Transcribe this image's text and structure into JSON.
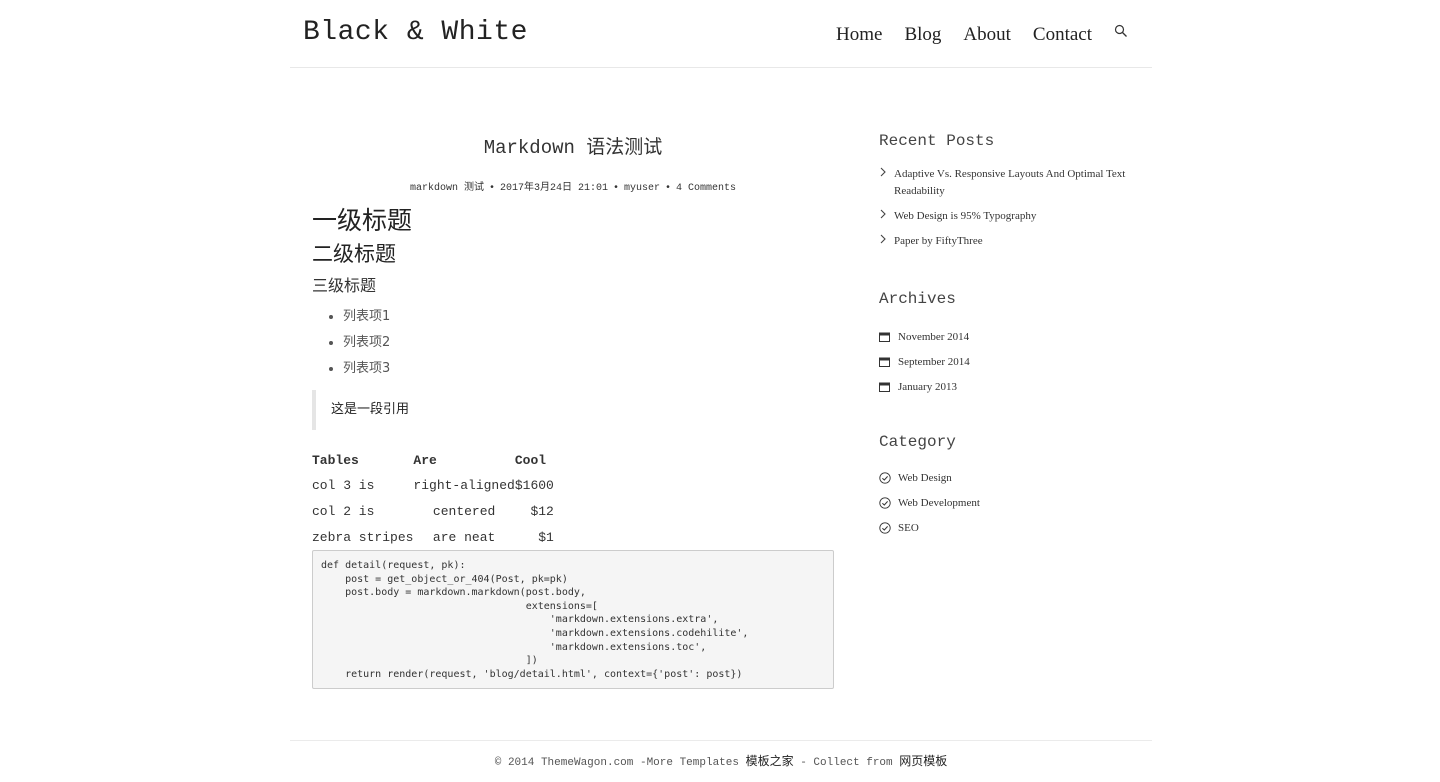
{
  "site": {
    "title": "Black & White"
  },
  "nav": {
    "items": [
      "Home",
      "Blog",
      "About",
      "Contact"
    ]
  },
  "post": {
    "title": "Markdown 语法测试",
    "meta": {
      "category": "markdown 测试",
      "date": "2017年3月24日 21:01",
      "author": "myuser",
      "comments": "4 Comments"
    },
    "h1": "一级标题",
    "h2": "二级标题",
    "h3": "三级标题",
    "list": [
      "列表项1",
      "列表项2",
      "列表项3"
    ],
    "quote": "这是一段引用",
    "table": {
      "headers": [
        "Tables",
        "Are",
        "Cool"
      ],
      "rows": [
        [
          "col 3 is",
          "right-aligned",
          "$1600"
        ],
        [
          "col 2 is",
          "centered",
          "$12"
        ],
        [
          "zebra stripes",
          "are neat",
          "$1"
        ]
      ]
    },
    "code": "def detail(request, pk):\n    post = get_object_or_404(Post, pk=pk)\n    post.body = markdown.markdown(post.body,\n                                  extensions=[\n                                      'markdown.extensions.extra',\n                                      'markdown.extensions.codehilite',\n                                      'markdown.extensions.toc',\n                                  ])\n    return render(request, 'blog/detail.html', context={'post': post})"
  },
  "sidebar": {
    "recent": {
      "title": "Recent Posts",
      "items": [
        "Adaptive Vs. Responsive Layouts And Optimal Text Readability",
        "Web Design is 95% Typography",
        "Paper by FiftyThree"
      ]
    },
    "archives": {
      "title": "Archives",
      "items": [
        "November 2014",
        "September 2014",
        "January 2013"
      ]
    },
    "category": {
      "title": "Category",
      "items": [
        "Web Design",
        "Web Development",
        "SEO"
      ]
    }
  },
  "footer": {
    "text": "© 2014 ThemeWagon.com -More Templates ",
    "cn1": "模板之家",
    "mid": " - Collect from ",
    "cn2": "网页模板"
  }
}
